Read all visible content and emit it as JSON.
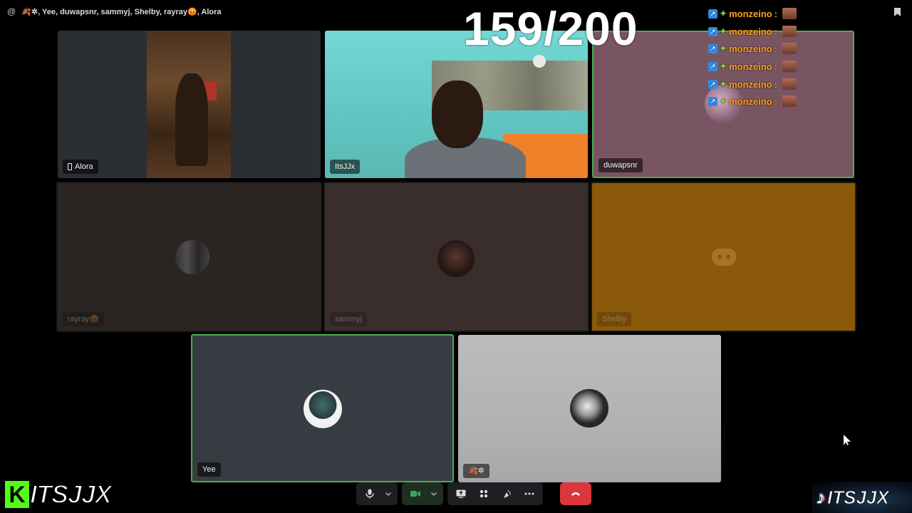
{
  "topbar": {
    "at_symbol": "@",
    "channel_title": "🍂✲, Yee, duwapsnr, sammyj, Shelby, rayray😡, Alora"
  },
  "overlay": {
    "counter": "159/200"
  },
  "tiles": {
    "alora": {
      "label": "Alora",
      "bg": "#2b2e33"
    },
    "itsjjx": {
      "label": "ItsJJx",
      "bg": "#6fd3cf"
    },
    "duwapsnr": {
      "label": "duwapsnr",
      "bg": "#795561",
      "border": "#4caf50"
    },
    "rayray": {
      "label": "rayray😡",
      "bg": "#2a2522"
    },
    "sammyj": {
      "label": "sammyj",
      "bg": "#3a2e2c"
    },
    "shelby": {
      "label": "Shelby",
      "bg": "#8a5a0a"
    },
    "yee": {
      "label": "Yee",
      "bg": "#373b42",
      "border": "#4caf50"
    },
    "snow": {
      "label": "🍂✲",
      "bg": "#b5b5b5"
    }
  },
  "chat": {
    "username": "monzeino",
    "separator": ":",
    "repeat_count": 6
  },
  "controls": {
    "mic_icon": "microphone-icon",
    "camera_icon": "camera-icon",
    "screenshare_icon": "screenshare-icon",
    "activities_icon": "activities-icon",
    "soundboard_icon": "soundboard-icon",
    "more_icon": "more-icon",
    "hangup_icon": "hangup-icon"
  },
  "branding": {
    "left_letter": "K",
    "left_text": "ITSJJX",
    "right_text": "ITSJJX_"
  },
  "colors": {
    "speaking_border": "#4caf50",
    "hangup": "#da373c",
    "kick_green": "#53fc18",
    "chat_name": "#ff9f1a"
  }
}
